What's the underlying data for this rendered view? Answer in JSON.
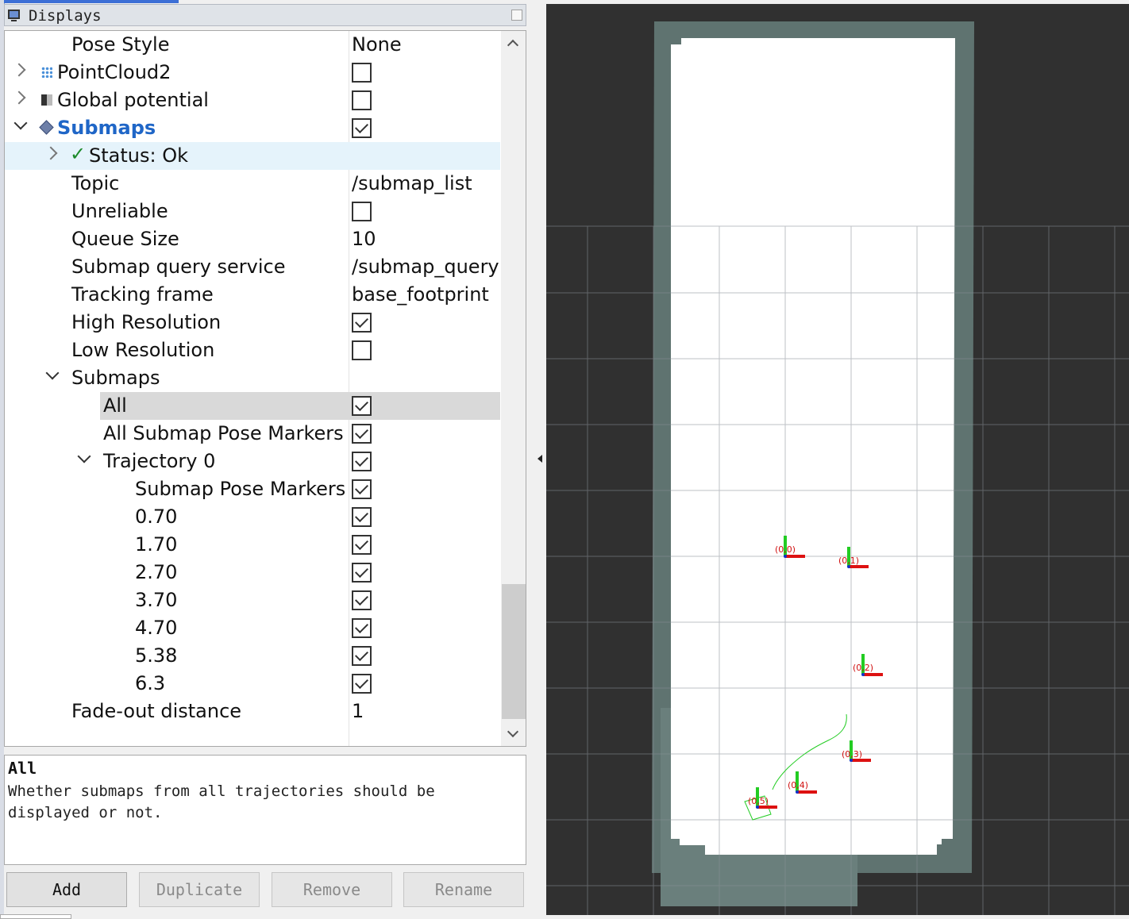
{
  "panel": {
    "title": "Displays"
  },
  "tree": {
    "rows": [
      {
        "name": "Pose Style",
        "value": "None"
      },
      {
        "name": "PointCloud2",
        "checked": false
      },
      {
        "name": "Global potential",
        "checked": false
      },
      {
        "name": "Submaps",
        "checked": true
      },
      {
        "name": "Status: Ok",
        "status_mark": "✓"
      },
      {
        "name": "Topic",
        "value": "/submap_list"
      },
      {
        "name": "Unreliable",
        "checked": false
      },
      {
        "name": "Queue Size",
        "value": "10"
      },
      {
        "name": "Submap query service",
        "value": "/submap_query"
      },
      {
        "name": "Tracking frame",
        "value": "base_footprint"
      },
      {
        "name": "High Resolution",
        "checked": true
      },
      {
        "name": "Low Resolution",
        "checked": false
      },
      {
        "name": "Submaps"
      },
      {
        "name": "All",
        "checked": true
      },
      {
        "name": "All Submap Pose Markers",
        "checked": true
      },
      {
        "name": "Trajectory 0",
        "checked": true
      },
      {
        "name": "Submap Pose Markers",
        "checked": true
      },
      {
        "name": "0.70",
        "checked": true
      },
      {
        "name": "1.70",
        "checked": true
      },
      {
        "name": "2.70",
        "checked": true
      },
      {
        "name": "3.70",
        "checked": true
      },
      {
        "name": "4.70",
        "checked": true
      },
      {
        "name": "5.38",
        "checked": true
      },
      {
        "name": "6.3",
        "checked": true
      },
      {
        "name": "Fade-out distance",
        "value": "1"
      }
    ]
  },
  "description": {
    "title": "All",
    "text": "Whether submaps from all trajectories should be displayed or not."
  },
  "buttons": {
    "add": "Add",
    "duplicate": "Duplicate",
    "remove": "Remove",
    "rename": "Rename"
  },
  "view": {
    "marker_labels": [
      "(0,0)",
      "(0,1)",
      "(0,2)",
      "(0,3)",
      "(0,4)",
      "(0,5)"
    ]
  },
  "colors": {
    "accent_blue": "#1f66c7",
    "status_green": "#1b8a2a",
    "view_bg": "#303030",
    "map_border": "#5f7370",
    "marker_red": "#dd1111",
    "marker_green": "#22cc22"
  }
}
